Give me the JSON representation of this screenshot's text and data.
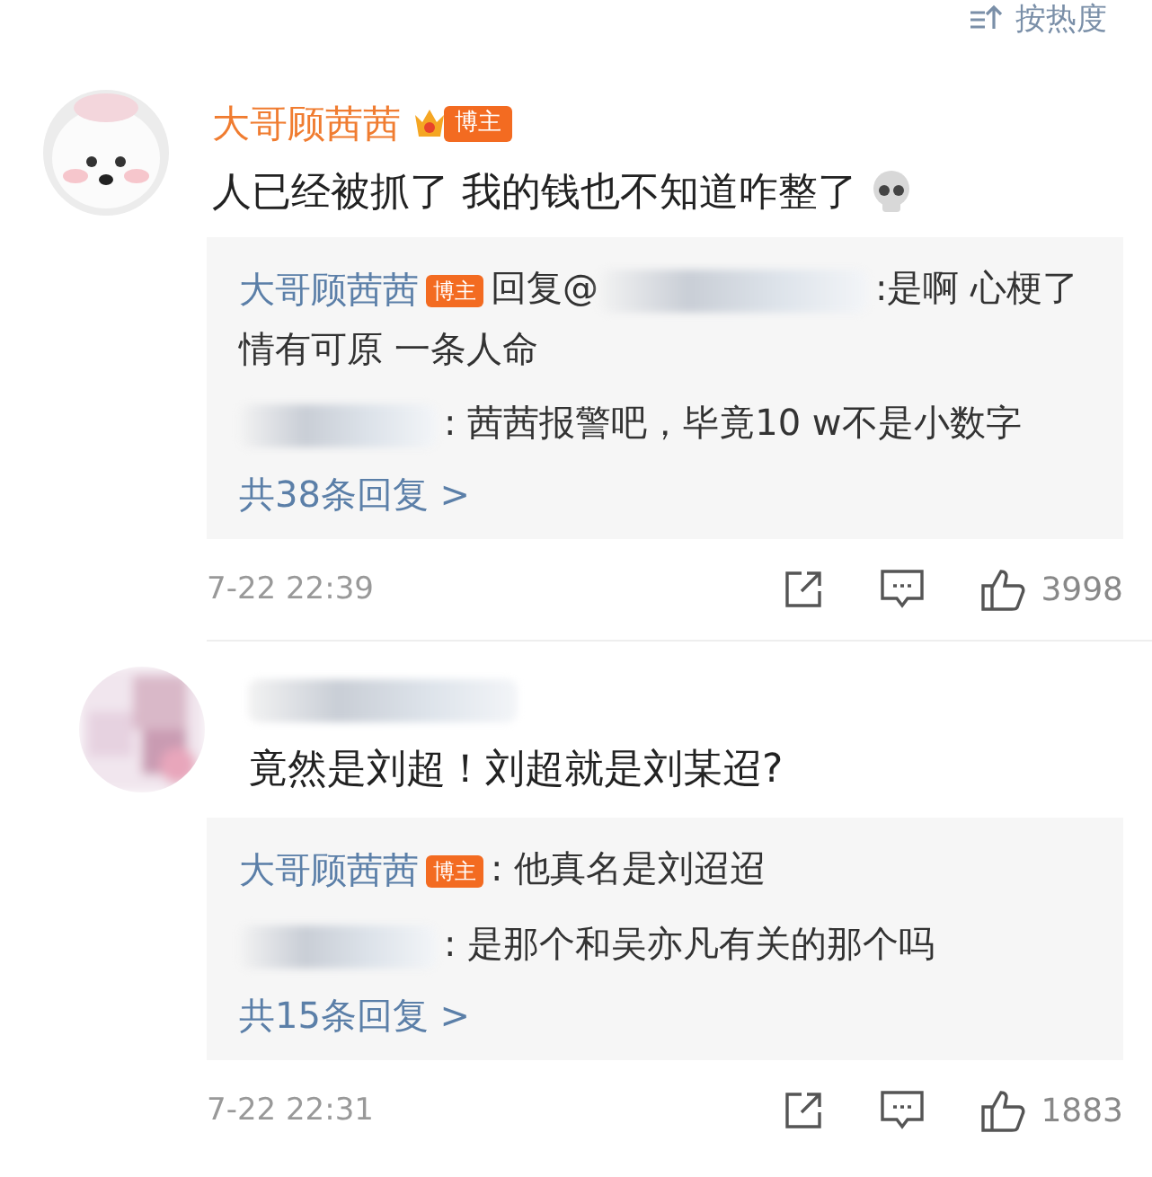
{
  "sort": {
    "label": "按热度"
  },
  "comments": [
    {
      "name": "大哥顾茜茜",
      "badge": "博主",
      "badge_crown": true,
      "text": "人已经被抓了 我的钱也不知道咋整了",
      "emoji": true,
      "replies": [
        {
          "author": "大哥顾茜茜",
          "badge": "博主",
          "reply_prefix": "回复@",
          "reply_to_redacted": true,
          "text": ":是啊 心梗了情有可原 一条人命"
        },
        {
          "author_redacted": true,
          "text": ": 茜茜报警吧，毕竟10 w不是小数字"
        }
      ],
      "more": "共38条回复 >",
      "date": "7-22 22:39",
      "likes": "3998"
    },
    {
      "name_redacted": true,
      "text": "竟然是刘超！刘超就是刘某迢?",
      "replies": [
        {
          "author": "大哥顾茜茜",
          "badge": "博主",
          "text": ": 他真名是刘迢迢"
        },
        {
          "author_redacted": true,
          "text": ": 是那个和吴亦凡有关的那个吗"
        }
      ],
      "more": "共15条回复 >",
      "date": "7-22 22:31",
      "likes": "1883"
    }
  ]
}
